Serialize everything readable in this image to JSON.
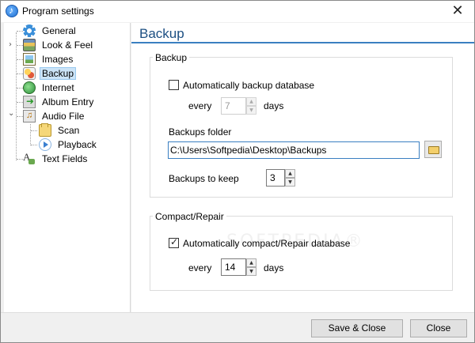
{
  "window": {
    "title": "Program settings",
    "close_glyph": "✕"
  },
  "tree": {
    "items": [
      {
        "label": "General",
        "icon": "gear-icon"
      },
      {
        "label": "Look & Feel",
        "icon": "look-feel-icon"
      },
      {
        "label": "Images",
        "icon": "images-icon"
      },
      {
        "label": "Backup",
        "icon": "backup-icon",
        "selected": true
      },
      {
        "label": "Internet",
        "icon": "globe-icon"
      },
      {
        "label": "Album Entry",
        "icon": "album-entry-icon"
      },
      {
        "label": "Audio File",
        "icon": "audio-file-icon"
      },
      {
        "label": "Scan",
        "icon": "folder-icon"
      },
      {
        "label": "Playback",
        "icon": "play-icon"
      },
      {
        "label": "Text Fields",
        "icon": "text-fields-icon"
      }
    ],
    "collapsed_glyph": "›",
    "expanded_glyph": "⌄"
  },
  "content": {
    "title": "Backup",
    "backup_group": {
      "label": "Backup",
      "auto_backup_label": "Automatically backup database",
      "auto_backup_checked": false,
      "every_label": "every",
      "every_value": "7",
      "days_label": "days",
      "folder_label": "Backups  folder",
      "folder_value": "C:\\Users\\Softpedia\\Desktop\\Backups",
      "keep_label": "Backups to keep",
      "keep_value": "3"
    },
    "compact_group": {
      "label": "Compact/Repair",
      "auto_compact_label": "Automatically compact/Repair database",
      "auto_compact_checked": true,
      "every_label": "every",
      "every_value": "14",
      "days_label": "days"
    },
    "watermark": "SOFTPEDIA®"
  },
  "footer": {
    "save_close_label": "Save & Close",
    "close_label": "Close"
  },
  "spin": {
    "up": "▲",
    "down": "▼"
  }
}
